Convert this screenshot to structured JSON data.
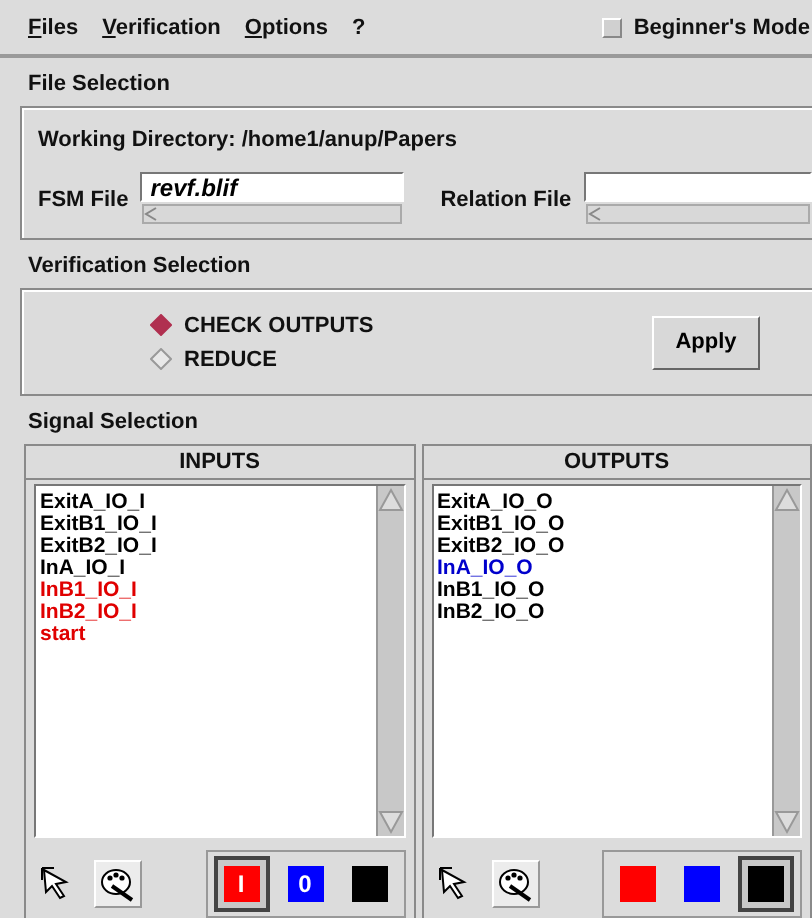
{
  "menu_bar": {
    "items": [
      "Files",
      "Verification",
      "Options",
      "?"
    ],
    "beginners_mode": {
      "label": "Beginner's Mode",
      "checked": false
    }
  },
  "file_selection": {
    "title": "File Selection",
    "working_directory": "Working Directory: /home1/anup/Papers",
    "fsm_file": {
      "label": "FSM File",
      "value": "revf.blif"
    },
    "relation_file": {
      "label": "Relation File"
    }
  },
  "verification_selection": {
    "title": "Verification Selection",
    "options": [
      {
        "label": "CHECK OUTPUTS",
        "selected": true
      },
      {
        "label": "REDUCE",
        "selected": false
      }
    ],
    "apply_button": "Apply"
  },
  "signal_selection": {
    "title": "Signal Selection",
    "panels": [
      {
        "title": "INPUTS",
        "signals": [
          {
            "name": "ExitA_IO_I",
            "color": "#000000"
          },
          {
            "name": "ExitB1_IO_I",
            "color": "#000000"
          },
          {
            "name": "ExitB2_IO_I",
            "color": "#000000"
          },
          {
            "name": "InA_IO_I",
            "color": "#000000"
          },
          {
            "name": "InB1_IO_I",
            "color": "#e00000"
          },
          {
            "name": "InB2_IO_I",
            "color": "#e00000"
          },
          {
            "name": "start",
            "color": "#e00000"
          }
        ],
        "swatches": [
          {
            "label": "I",
            "color": "#ff0000",
            "selected": true
          },
          {
            "label": "0",
            "color": "#0000ff",
            "selected": false
          },
          {
            "color": "#000000",
            "selected": false
          }
        ]
      },
      {
        "title": "OUTPUTS",
        "signals": [
          {
            "name": "ExitA_IO_O",
            "color": "#000000"
          },
          {
            "name": "ExitB1_IO_O",
            "color": "#000000"
          },
          {
            "name": "ExitB2_IO_O",
            "color": "#000000"
          },
          {
            "name": "InA_IO_O",
            "color": "#0000cc"
          },
          {
            "name": "InB1_IO_O",
            "color": "#000000"
          },
          {
            "name": "InB2_IO_O",
            "color": "#000000"
          }
        ],
        "swatches": [
          {
            "color": "#ff0000",
            "selected": false
          },
          {
            "color": "#0000ff",
            "selected": false
          },
          {
            "color": "#000000",
            "selected": true
          }
        ]
      }
    ]
  }
}
